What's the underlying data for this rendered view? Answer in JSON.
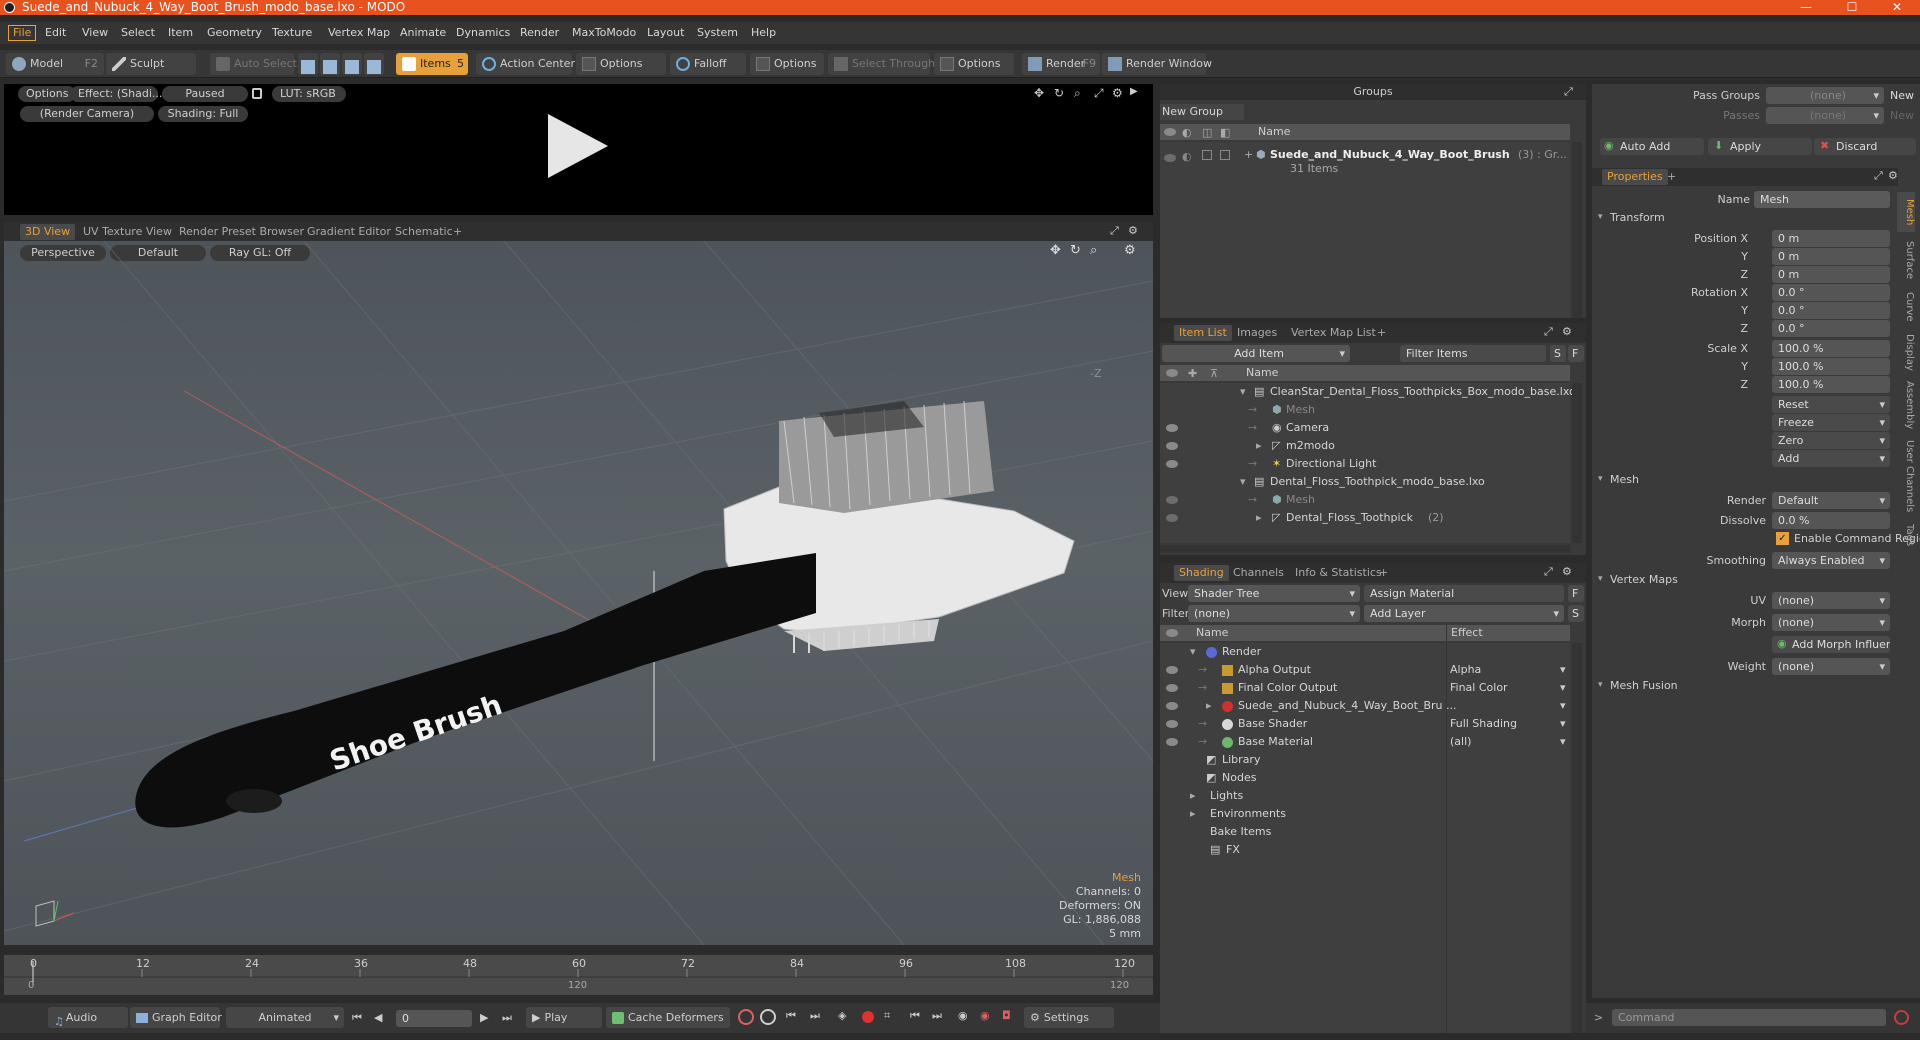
{
  "window": {
    "title": "Suede_and_Nubuck_4_Way_Boot_Brush_modo_base.lxo - MODO",
    "minimize": "—",
    "maximize": "☐",
    "close": "✕"
  },
  "menu": [
    "File",
    "Edit",
    "View",
    "Select",
    "Item",
    "Geometry",
    "Texture",
    "Vertex Map",
    "Animate",
    "Dynamics",
    "Render",
    "MaxToModo",
    "Layout",
    "System",
    "Help"
  ],
  "toolbar": {
    "model": "Model",
    "model_key": "F2",
    "sculpt": "Sculpt",
    "auto_select": "Auto Select",
    "items": "Items",
    "items_key": "5",
    "action_center": "Action Center",
    "options1": "Options",
    "falloff": "Falloff",
    "options2": "Options",
    "select_through": "Select Through",
    "options3": "Options",
    "render": "Render",
    "render_key": "F9",
    "render_window": "Render Window"
  },
  "preview": {
    "options": "Options",
    "effect": "Effect: (Shadi...",
    "paused": "Paused",
    "lut": "LUT: sRGB",
    "camera": "(Render Camera)",
    "shading": "Shading: Full"
  },
  "viewport_tabs": [
    "3D View",
    "UV Texture View",
    "Render Preset Browser",
    "Gradient Editor",
    "Schematic",
    "+"
  ],
  "viewport": {
    "perspective": "Perspective",
    "default": "Default",
    "raygl": "Ray GL: Off",
    "brush_text": "Shoe Brush",
    "info_title": "Mesh",
    "info_channels": "Channels: 0",
    "info_deformers": "Deformers: ON",
    "info_gl": "GL: 1,886,088",
    "info_size": "5 mm",
    "axis_label": "-Z"
  },
  "timeline": {
    "ticks": [
      "0",
      "12",
      "24",
      "36",
      "48",
      "60",
      "72",
      "84",
      "96",
      "108",
      "120"
    ],
    "sub_left": "0",
    "sub_mid": "120",
    "sub_right": "120"
  },
  "bottom": {
    "audio": "Audio",
    "graph_editor": "Graph Editor",
    "animated": "Animated",
    "frame": "0",
    "play": "Play",
    "cache": "Cache Deformers",
    "settings": "Settings",
    "command_placeholder": "Command"
  },
  "groups": {
    "header": "Groups",
    "new_group": "New Group",
    "name_col": "Name",
    "item_name": "Suede_and_Nubuck_4_Way_Boot_Brush",
    "item_suffix": "(3) : Gr...",
    "item_count": "31 Items"
  },
  "itemlist": {
    "tabs": [
      "Item List",
      "Images",
      "Vertex Map List",
      "+"
    ],
    "add_item": "Add Item",
    "filter": "Filter Items",
    "s": "S",
    "f": "F",
    "name_col": "Name",
    "rows": [
      {
        "text": "CleanStar_Dental_Floss_Toothpicks_Box_modo_base.lxo",
        "indent": 0,
        "dim": false
      },
      {
        "text": "Mesh",
        "indent": 1,
        "dim": true
      },
      {
        "text": "Camera",
        "indent": 1,
        "dim": false
      },
      {
        "text": "m2modo",
        "indent": 1,
        "dim": false
      },
      {
        "text": "Directional Light",
        "indent": 1,
        "dim": false
      },
      {
        "text": "Dental_Floss_Toothpick_modo_base.lxo",
        "indent": 0,
        "dim": false
      },
      {
        "text": "Mesh",
        "indent": 1,
        "dim": true
      },
      {
        "text": "Dental_Floss_Toothpick",
        "indent": 1,
        "dim": false,
        "suffix": "(2)"
      }
    ]
  },
  "shading": {
    "tabs": [
      "Shading",
      "Channels",
      "Info & Statistics",
      "+"
    ],
    "view_label": "View",
    "view_value": "Shader Tree",
    "assign_material": "Assign Material",
    "filter_label": "Filter",
    "filter_value": "(none)",
    "add_layer": "Add Layer",
    "f": "F",
    "s": "S",
    "name_col": "Name",
    "effect_col": "Effect",
    "rows": [
      {
        "name": "Render",
        "effect": "",
        "indent": 0
      },
      {
        "name": "Alpha Output",
        "effect": "Alpha",
        "indent": 1
      },
      {
        "name": "Final Color Output",
        "effect": "Final Color",
        "indent": 1
      },
      {
        "name": "Suede_and_Nubuck_4_Way_Boot_Bru ...",
        "effect": "",
        "indent": 1
      },
      {
        "name": "Base Shader",
        "effect": "Full Shading",
        "indent": 1
      },
      {
        "name": "Base Material",
        "effect": "(all)",
        "indent": 1
      },
      {
        "name": "Library",
        "effect": "",
        "indent": 0
      },
      {
        "name": "Nodes",
        "effect": "",
        "indent": 0
      },
      {
        "name": "Lights",
        "effect": "",
        "indent": 0
      },
      {
        "name": "Environments",
        "effect": "",
        "indent": 0
      },
      {
        "name": "Bake Items",
        "effect": "",
        "indent": 0
      },
      {
        "name": "FX",
        "effect": "",
        "indent": 0
      }
    ]
  },
  "properties": {
    "pass_groups": "Pass Groups",
    "pass_groups_val": "(none)",
    "new1": "New",
    "passes": "Passes",
    "passes_val": "(none)",
    "new2": "New",
    "auto_add": "Auto Add",
    "apply": "Apply",
    "discard": "Discard",
    "tab": "Properties",
    "plus": "+",
    "name_label": "Name",
    "name_value": "Mesh",
    "transform": "Transform",
    "position_x": "Position X",
    "y": "Y",
    "z": "Z",
    "pos": [
      "0 m",
      "0 m",
      "0 m"
    ],
    "rotation_x": "Rotation X",
    "rot": [
      "0.0 °",
      "0.0 °",
      "0.0 °"
    ],
    "scale_x": "Scale X",
    "scale": [
      "100.0 %",
      "100.0 %",
      "100.0 %"
    ],
    "reset": "Reset",
    "freeze": "Freeze",
    "zero": "Zero",
    "add": "Add",
    "mesh": "Mesh",
    "render_label": "Render",
    "render_value": "Default",
    "dissolve_label": "Dissolve",
    "dissolve_value": "0.0 %",
    "enable_cmd": "Enable Command Regions",
    "smoothing_label": "Smoothing",
    "smoothing_value": "Always Enabled",
    "vertex_maps": "Vertex Maps",
    "uv_label": "UV",
    "uv_value": "(none)",
    "morph_label": "Morph",
    "morph_value": "(none)",
    "add_morph": "Add Morph Influence",
    "weight_label": "Weight",
    "weight_value": "(none)",
    "mesh_fusion": "Mesh Fusion",
    "side_tabs": [
      "Mesh",
      "Surface",
      "Curve",
      "Display",
      "Assembly",
      "User Channels",
      "Tags"
    ]
  },
  "colors": {
    "accent": "#e8a03a",
    "titlebar": "#e8521e"
  }
}
